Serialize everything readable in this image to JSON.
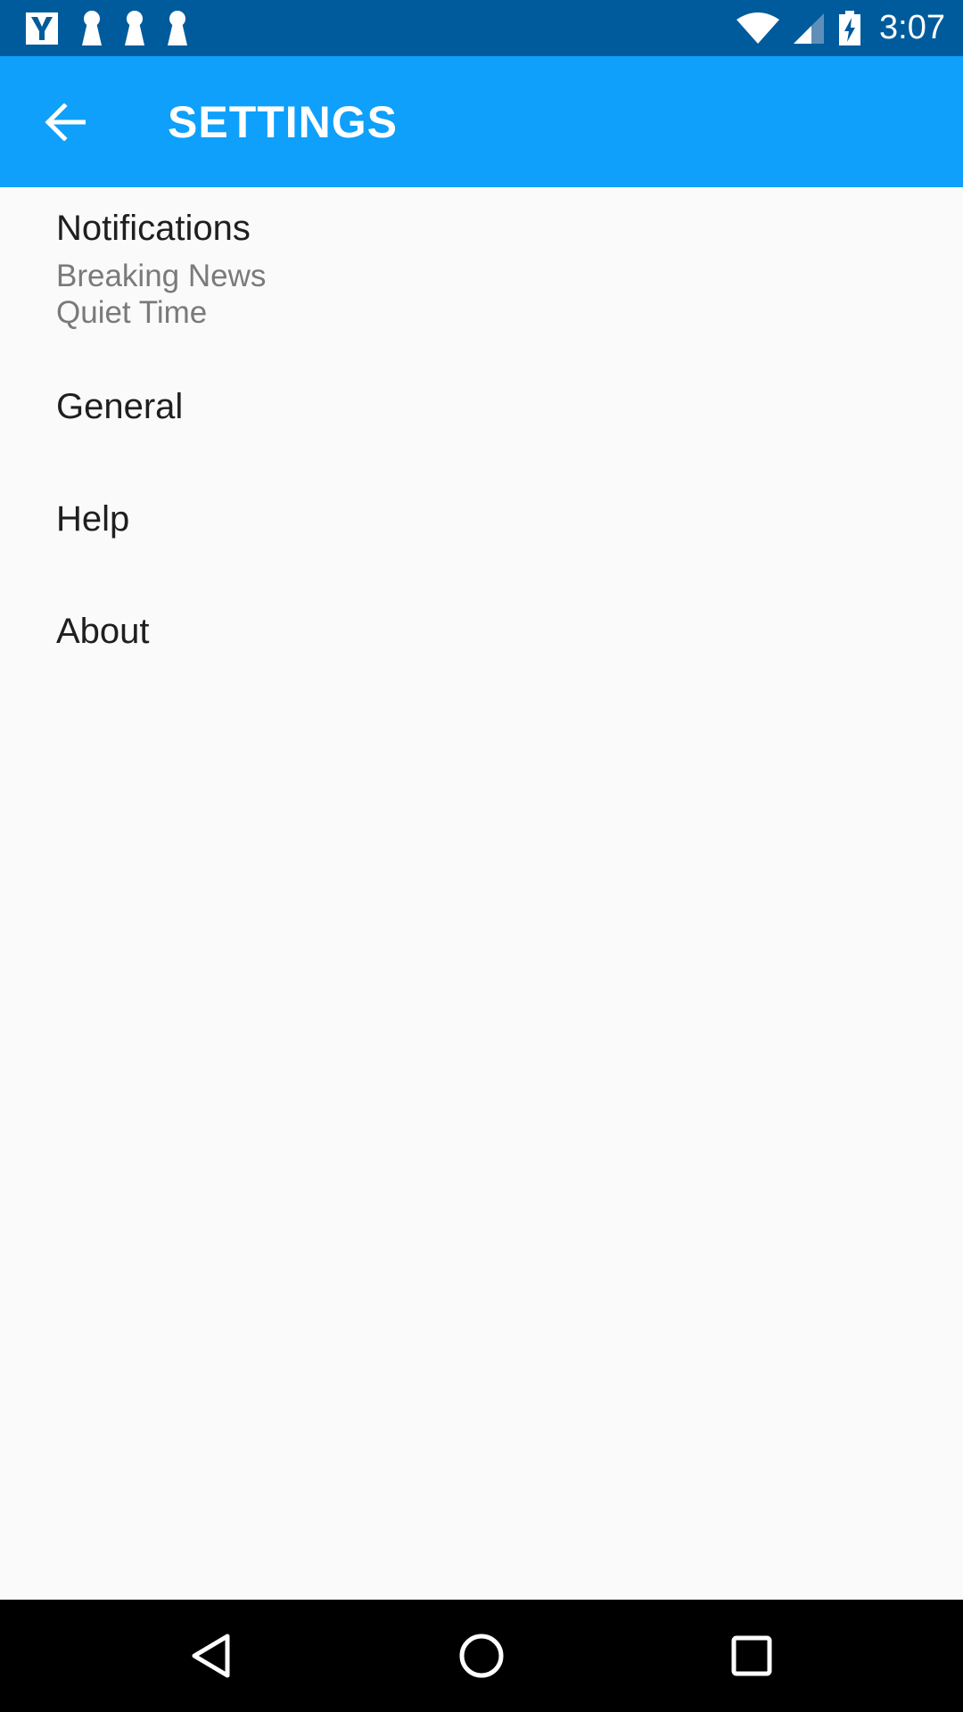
{
  "status_bar": {
    "time": "3:07",
    "left_icons": [
      "yahoo-icon",
      "keyhole-icon",
      "keyhole-icon",
      "keyhole-icon"
    ],
    "right_icons": [
      "wifi-icon",
      "cell-signal-icon",
      "battery-charging-icon"
    ]
  },
  "app_bar": {
    "title": "SETTINGS",
    "back_icon": "arrow-back-icon",
    "color": "#0ea0fb"
  },
  "settings": {
    "notifications": {
      "title": "Notifications",
      "subtitle_1": "Breaking News",
      "subtitle_2": "Quiet Time"
    },
    "general": {
      "title": "General"
    },
    "help": {
      "title": "Help"
    },
    "about": {
      "title": "About"
    }
  },
  "nav_bar": {
    "buttons": [
      "nav-back-icon",
      "nav-home-icon",
      "nav-recents-icon"
    ]
  },
  "colors": {
    "status_bar": "#005b9c",
    "app_bar": "#0ea0fb",
    "background": "#fafafa",
    "nav_bar": "#000000"
  }
}
